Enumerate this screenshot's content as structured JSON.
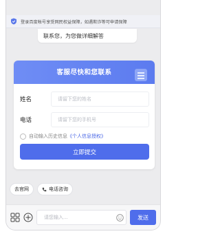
{
  "notice": {
    "text": "登录百度帐号享受网民权益保障，如遇欺诈等可申请保障"
  },
  "message": {
    "text": "联系您，为您做详细解答"
  },
  "form": {
    "title": "客服尽快和您联系",
    "name_label": "姓名",
    "name_placeholder": "请留下您的姓名",
    "phone_label": "电话",
    "phone_placeholder": "请留下您的手机号",
    "autofill_text": "自动输入历史信息",
    "privacy_link": "《个人信息授权》",
    "submit_label": "立即提交"
  },
  "quick_actions": [
    {
      "label": "去官网"
    },
    {
      "label": "电话咨询"
    }
  ],
  "composer": {
    "placeholder": "请您输入...",
    "send_label": "发送"
  },
  "colors": {
    "primary": "#4f6deb",
    "header_gradient_start": "#6f8df5"
  },
  "icons": [
    "shield-icon",
    "grid-icon",
    "plus-icon",
    "emoji-icon",
    "phone-icon",
    "menu-icon"
  ]
}
